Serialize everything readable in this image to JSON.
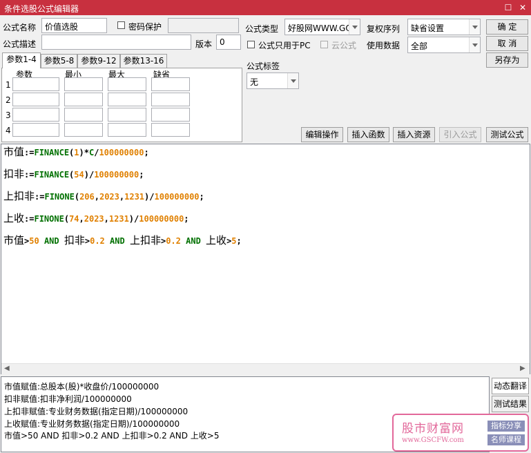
{
  "window": {
    "title": "条件选股公式编辑器"
  },
  "form": {
    "name_label": "公式名称",
    "name_value": "价值选股",
    "password_label": "密码保护",
    "desc_label": "公式描述",
    "desc_value": "",
    "version_label": "版本",
    "version_value": "0",
    "type_label": "公式类型",
    "type_value": "好股网WWW.GO",
    "pc_only_label": "公式只用于PC",
    "cloud_label": "云公式",
    "fq_label": "复权序列",
    "fq_value": "缺省设置",
    "data_label": "使用数据",
    "data_value": "全部",
    "tag_label": "公式标签",
    "tag_value": "无"
  },
  "buttons": {
    "ok": "确 定",
    "cancel": "取 消",
    "save_as": "另存为",
    "edit_ops": "编辑操作",
    "insert_func": "插入函数",
    "insert_res": "插入资源",
    "import_formula": "引入公式",
    "test_formula": "测试公式"
  },
  "tabs": [
    "参数1-4",
    "参数5-8",
    "参数9-12",
    "参数13-16"
  ],
  "param_table": {
    "headers": [
      "参数",
      "最小",
      "最大",
      "缺省"
    ],
    "rows": [
      "1",
      "2",
      "3",
      "4"
    ]
  },
  "code": {
    "line1": {
      "var": "市值",
      "assign": ":=",
      "fn": "FINANCE",
      "p1": "(",
      "n1": "1",
      "p2": ")*",
      "v2": "C",
      "op": "/",
      "n2": "100000000",
      "end": ";"
    },
    "line2": {
      "var": "扣非",
      "assign": ":=",
      "fn": "FINANCE",
      "p1": "(",
      "n1": "54",
      "p2": ")",
      "op": "/",
      "n2": "100000000",
      "end": ";"
    },
    "line3": {
      "var": "上扣非",
      "assign": ":=",
      "fn": "FINONE",
      "p1": "(",
      "n1": "206",
      "c1": ",",
      "n2": "2023",
      "c2": ",",
      "n3": "1231",
      "p2": ")",
      "op": "/",
      "n4": "100000000",
      "end": ";"
    },
    "line4": {
      "var": "上收",
      "assign": ":=",
      "fn": "FINONE",
      "p1": "(",
      "n1": "74",
      "c1": ",",
      "n2": "2023",
      "c2": ",",
      "n3": "1231",
      "p2": ")",
      "op": "/",
      "n4": "100000000",
      "end": ";"
    },
    "line5": {
      "v1": "市值",
      "g1": ">",
      "n1": "50",
      "and1": "AND",
      "v2": "扣非",
      "g2": ">",
      "n2": "0.2",
      "and2": "AND",
      "v3": "上扣非",
      "g3": ">",
      "n3": "0.2",
      "and3": "AND",
      "v4": "上收",
      "g4": ">",
      "n4": "5",
      "end": ";"
    }
  },
  "output_lines": [
    "市值赋值:总股本(股)*收盘价/100000000",
    "扣非赋值:扣非净利润/100000000",
    "上扣非赋值:专业财务数据(指定日期)/100000000",
    "上收赋值:专业财务数据(指定日期)/100000000",
    "市值>50 AND 扣非>0.2 AND 上扣非>0.2 AND 上收>5"
  ],
  "side_tabs": {
    "dynamic": "动态翻译",
    "test_result": "测试结果"
  },
  "watermark": {
    "main": "股市财富网",
    "url": "www.GSCFW.com",
    "tag1": "指标分享",
    "tag2": "名师课程"
  },
  "colors": {
    "titlebar": "#c8303f",
    "function": "#007000",
    "number": "#e08000",
    "watermark": "#e2689a"
  }
}
